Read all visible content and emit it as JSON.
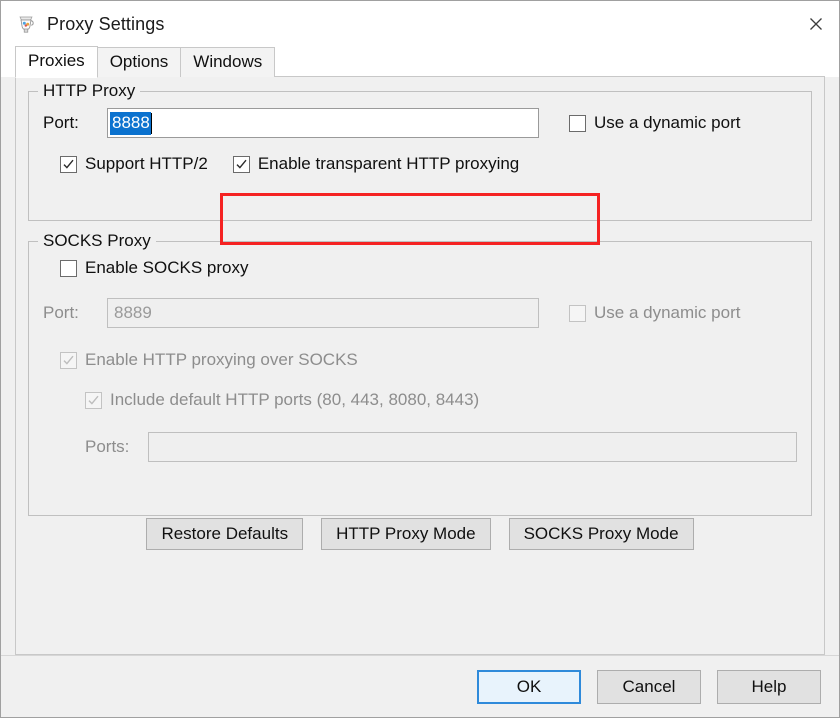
{
  "window": {
    "title": "Proxy Settings",
    "icon": "fiddler-jug-icon",
    "close_label": "✕"
  },
  "tabs": [
    {
      "label": "Proxies",
      "active": true
    },
    {
      "label": "Options",
      "active": false
    },
    {
      "label": "Windows",
      "active": false
    }
  ],
  "http_proxy": {
    "group_title": "HTTP Proxy",
    "port_label": "Port:",
    "port_value": "8888",
    "port_selected": true,
    "dynamic_port": {
      "label": "Use a dynamic port",
      "checked": false,
      "enabled": true
    },
    "support_http2": {
      "label": "Support HTTP/2",
      "checked": true,
      "enabled": true
    },
    "transparent_proxying": {
      "label": "Enable transparent HTTP proxying",
      "checked": true,
      "enabled": true
    }
  },
  "socks_proxy": {
    "group_title": "SOCKS Proxy",
    "enable_socks": {
      "label": "Enable SOCKS proxy",
      "checked": false,
      "enabled": true
    },
    "port_label": "Port:",
    "port_value": "8889",
    "dynamic_port": {
      "label": "Use a dynamic port",
      "checked": false,
      "enabled": false
    },
    "http_over_socks": {
      "label": "Enable HTTP proxying over SOCKS",
      "checked": true,
      "enabled": false
    },
    "default_http_ports": {
      "label": "Include default HTTP ports (80, 443, 8080, 8443)",
      "checked": true,
      "enabled": false
    },
    "ports_label": "Ports:",
    "ports_value": ""
  },
  "mode_buttons": [
    {
      "label": "Restore Defaults"
    },
    {
      "label": "HTTP Proxy Mode"
    },
    {
      "label": "SOCKS Proxy Mode"
    }
  ],
  "footer_buttons": [
    {
      "label": "OK",
      "default": true
    },
    {
      "label": "Cancel",
      "default": false
    },
    {
      "label": "Help",
      "default": false
    }
  ],
  "annotation": {
    "color": "#f52222",
    "target": "Enable transparent HTTP proxying"
  },
  "colors": {
    "dialog_bg": "#f0f0f0",
    "titlebar_bg": "#ffffff",
    "selection_blue": "#0b72cf",
    "default_button_border": "#2f8ada",
    "annotation_red": "#f52222",
    "disabled_text": "#8d8d8d"
  }
}
